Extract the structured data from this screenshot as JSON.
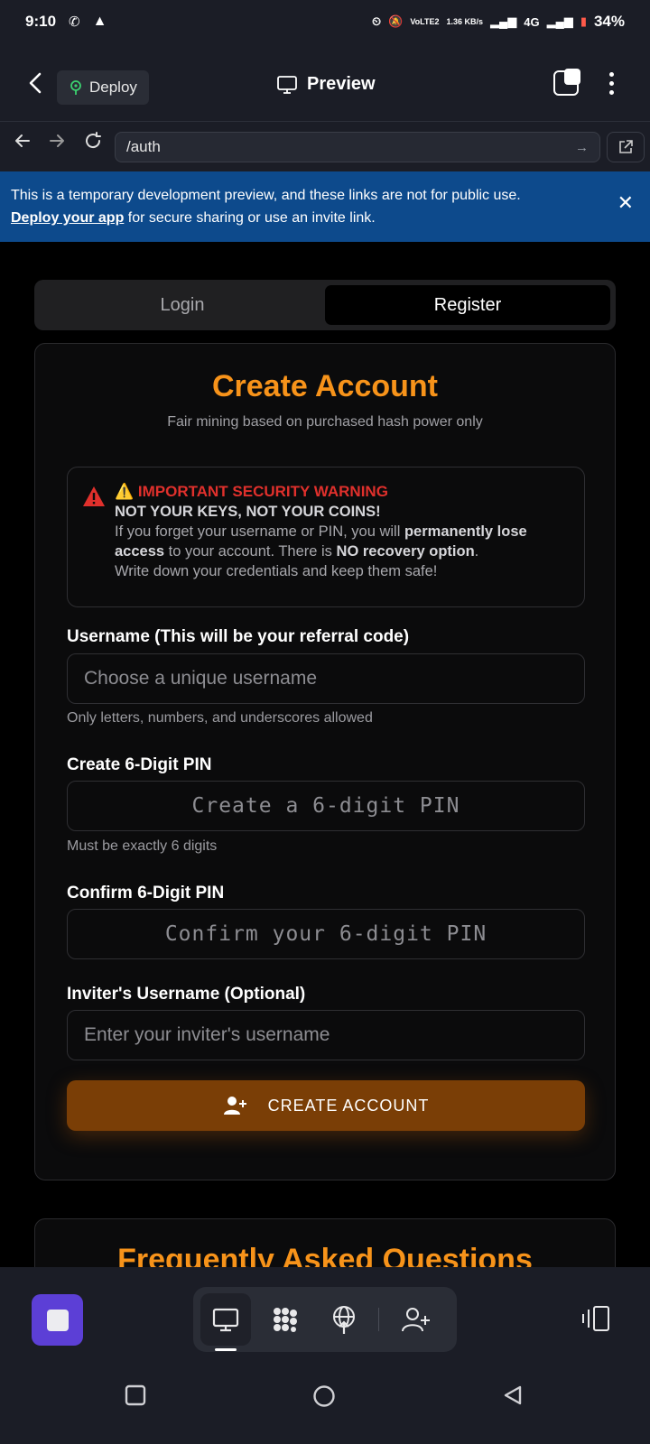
{
  "status_bar": {
    "time": "9:10",
    "network": "4G",
    "speed": "1.36 KB/s",
    "volte": "VoLTE2",
    "battery": "34%"
  },
  "header": {
    "deploy_label": "Deploy",
    "title": "Preview"
  },
  "url_bar": {
    "value": "/auth"
  },
  "banner": {
    "text": "This is a temporary development preview, and these links are not for public use.",
    "link_text": "Deploy your app",
    "rest_text": " for secure sharing or use an invite link."
  },
  "auth_tabs": [
    {
      "label": "Login",
      "active": false
    },
    {
      "label": "Register",
      "active": true
    }
  ],
  "form": {
    "title": "Create Account",
    "subtitle": "Fair mining based on purchased hash power only",
    "warning": {
      "title": "⚠️ IMPORTANT SECURITY WARNING",
      "headline": "NOT YOUR KEYS, NOT YOUR COINS!",
      "line1_a": "If you forget your username or PIN, you will ",
      "line1_b": "permanently lose access",
      "line1_c": " to your account. There is ",
      "line1_d": "NO recovery option",
      "line1_e": ".",
      "line2": "Write down your credentials and keep them safe!"
    },
    "username_label": "Username (This will be your referral code)",
    "username_placeholder": "Choose a unique username",
    "username_hint": "Only letters, numbers, and underscores allowed",
    "pin_label": "Create 6-Digit PIN",
    "pin_placeholder": "Create a 6-digit PIN",
    "pin_hint": "Must be exactly 6 digits",
    "confirm_label": "Confirm 6-Digit PIN",
    "confirm_placeholder": "Confirm your 6-digit PIN",
    "inviter_label": "Inviter's Username (Optional)",
    "inviter_placeholder": "Enter your inviter's username",
    "submit_label": "CREATE ACCOUNT"
  },
  "faq": {
    "title": "Frequently Asked Questions"
  },
  "colors": {
    "accent": "#f7931a",
    "warning": "#e0302c",
    "button": "#7a3e06",
    "banner": "#0d4a8c",
    "stop": "#5c3fd6"
  }
}
